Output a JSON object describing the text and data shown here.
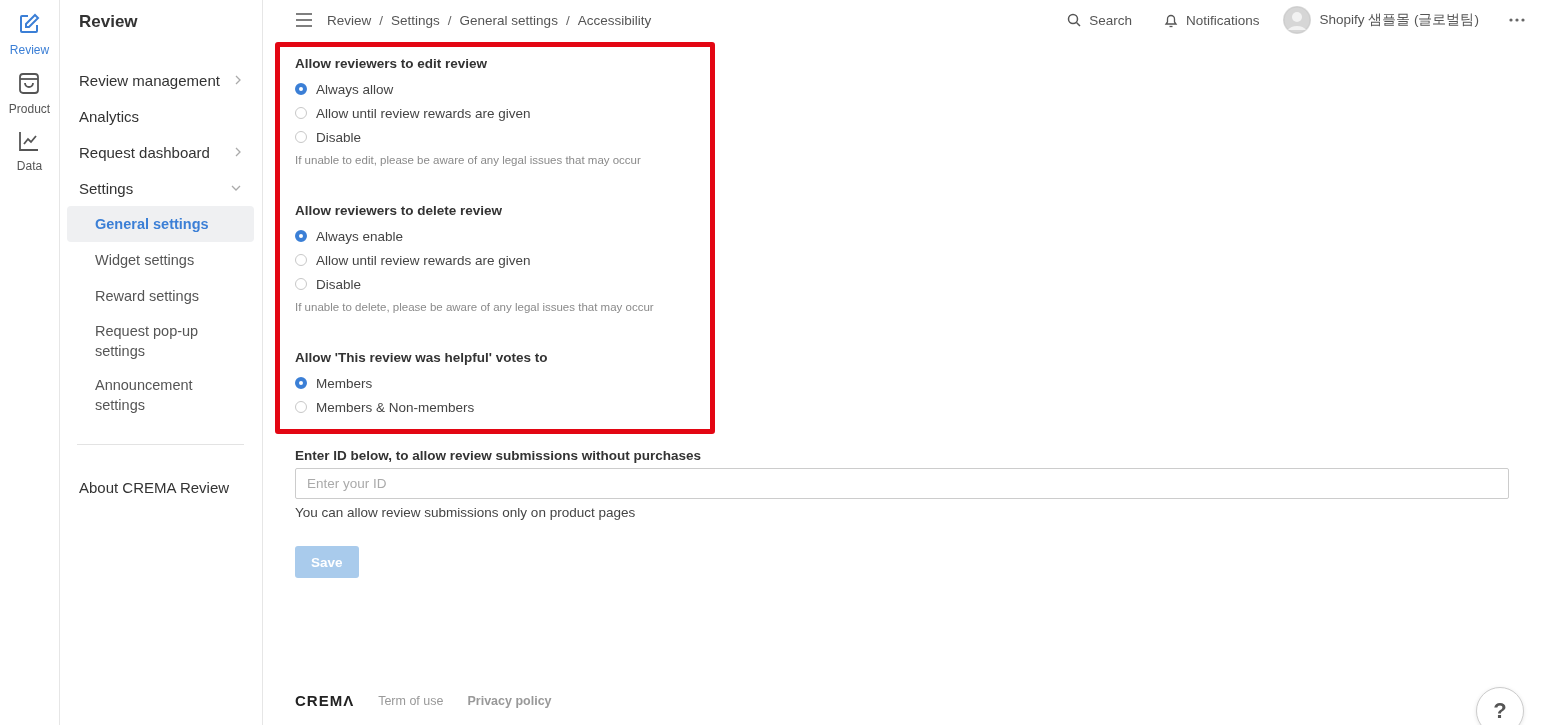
{
  "rail": [
    {
      "kind": "edit",
      "label": "Review",
      "selected": true
    },
    {
      "kind": "bag",
      "label": "Product",
      "selected": false
    },
    {
      "kind": "chart",
      "label": "Data",
      "selected": false
    }
  ],
  "sidebar": {
    "title": "Review",
    "items": [
      {
        "label": "Review management",
        "expanded": false
      },
      {
        "label": "Analytics"
      },
      {
        "label": "Request dashboard",
        "expanded": false
      },
      {
        "label": "Settings",
        "expanded": true,
        "children": [
          {
            "label": "General settings",
            "selected": true
          },
          {
            "label": "Widget settings",
            "selected": false
          },
          {
            "label": "Reward settings",
            "selected": false
          },
          {
            "label": "Request pop-up settings",
            "selected": false
          },
          {
            "label": "Announcement settings",
            "selected": false
          }
        ]
      }
    ],
    "footer_items": [
      {
        "label": "About CREMA Review"
      }
    ]
  },
  "topbar": {
    "breadcrumb": [
      {
        "label": "Review",
        "separator": "/"
      },
      {
        "label": "Settings",
        "separator": "/"
      },
      {
        "label": "General settings",
        "separator": "/"
      },
      {
        "label": "Accessibility"
      }
    ],
    "search": "Search",
    "notifications": "Notifications",
    "user": "Shopify 샘플몰 (글로벌팀)"
  },
  "groups": [
    {
      "title": "Allow reviewers to edit review",
      "options": [
        {
          "label": "Always allow",
          "selected": true
        },
        {
          "label": "Allow until review rewards are given",
          "selected": false
        },
        {
          "label": "Disable",
          "selected": false
        }
      ],
      "hint": "If unable to edit, please be aware of any legal issues that may occur"
    },
    {
      "title": "Allow reviewers to delete review",
      "options": [
        {
          "label": "Always enable",
          "selected": true
        },
        {
          "label": "Allow until review rewards are given",
          "selected": false
        },
        {
          "label": "Disable",
          "selected": false
        }
      ],
      "hint": "If unable to delete, please be aware of any legal issues that may occur"
    },
    {
      "title": "Allow 'This review was helpful' votes to",
      "options": [
        {
          "label": "Members",
          "selected": true
        },
        {
          "label": "Members & Non-members",
          "selected": false
        }
      ]
    }
  ],
  "id_field": {
    "label": "Enter ID below, to allow review submissions without purchases",
    "placeholder": "Enter your ID",
    "help": "You can allow review submissions only on product pages"
  },
  "save": {
    "label": "Save",
    "disabled": true
  },
  "footer": {
    "logo": "CREMΛ",
    "links": [
      {
        "label": "Term of use",
        "strong": false
      },
      {
        "label": "Privacy policy",
        "strong": true
      }
    ]
  },
  "help_button": "?"
}
